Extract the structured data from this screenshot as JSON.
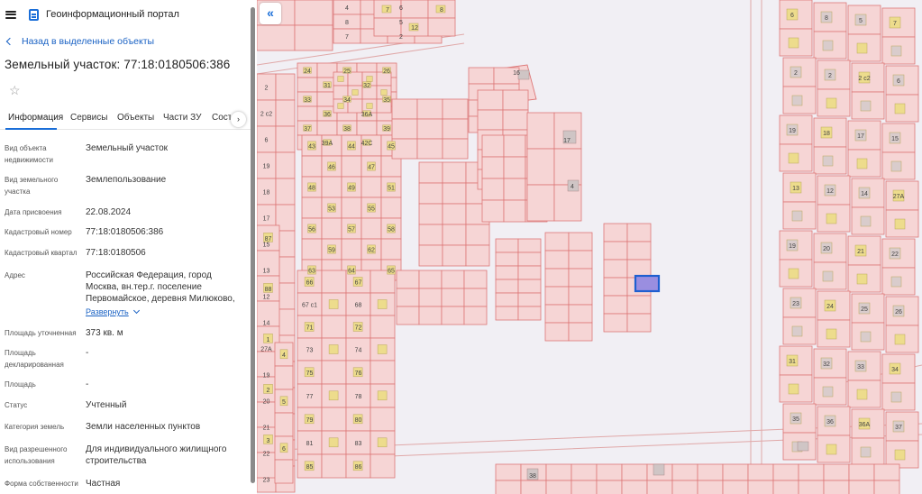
{
  "header": {
    "app_title": "Геоинформационный портал",
    "menu_icon": "hamburger-icon",
    "logo_icon": "portal-logo-icon"
  },
  "back_link": {
    "label": "Назад в выделенные объекты"
  },
  "object": {
    "title": "Земельный участок: 77:18:0180506:386"
  },
  "tabs": [
    {
      "label": "Информация",
      "active": true
    },
    {
      "label": "Сервисы"
    },
    {
      "label": "Объекты"
    },
    {
      "label": "Части ЗУ"
    },
    {
      "label": "Состав"
    }
  ],
  "tabs_more_icon": "chevron-right-icon",
  "properties": {
    "type": {
      "label": "Вид объекта недвижимости",
      "value": "Земельный участок"
    },
    "land_kind": {
      "label": "Вид земельного участка",
      "value": "Землепользование"
    },
    "assigned_date": {
      "label": "Дата присвоения",
      "value": "22.08.2024"
    },
    "cad_number": {
      "label": "Кадастровый номер",
      "value": "77:18:0180506:386"
    },
    "cad_block": {
      "label": "Кадастровый квартал",
      "value": "77:18:0180506"
    },
    "address": {
      "label": "Адрес",
      "value": "Российская Федерация, город Москва, вн.тер.г. поселение Первомайское, деревня Милюково,",
      "expand": "Развернуть"
    },
    "area_specified": {
      "label": "Площадь уточненная",
      "value": "373 кв. м"
    },
    "area_declared": {
      "label": "Площадь декларированная",
      "value": "-"
    },
    "area": {
      "label": "Площадь",
      "value": "-"
    },
    "status": {
      "label": "Статус",
      "value": "Учтенный"
    },
    "category": {
      "label": "Категория земель",
      "value": "Земли населенных пунктов"
    },
    "permitted_use": {
      "label": "Вид разрешенного использования",
      "value": "Для индивидуального жилищного строительства"
    },
    "ownership": {
      "label": "Форма собственности",
      "value": "Частная"
    }
  },
  "map": {
    "collapse_icon": "double-chevron-left-icon",
    "labels": [
      "4",
      "6",
      "8",
      "5",
      "7",
      "2",
      "2",
      "2 с2",
      "6",
      "19",
      "18",
      "17",
      "15",
      "13",
      "12",
      "14",
      "27А",
      "19",
      "20",
      "21",
      "22",
      "23",
      "24",
      "25",
      "26",
      "31",
      "32",
      "33",
      "34",
      "35",
      "36",
      "36А",
      "37",
      "38",
      "39",
      "39А",
      "42С",
      "43",
      "44",
      "45",
      "46",
      "47",
      "48",
      "49",
      "51",
      "53",
      "55",
      "56",
      "57",
      "58",
      "59",
      "62",
      "63",
      "64",
      "65",
      "66",
      "67",
      "67 с1",
      "68",
      "71",
      "72",
      "73",
      "74",
      "75",
      "76",
      "77",
      "78",
      "79",
      "80",
      "81",
      "83",
      "85",
      "86",
      "87",
      "88",
      "1",
      "2",
      "3",
      "4",
      "5",
      "6",
      "7",
      "8",
      "12",
      "16",
      "17"
    ]
  },
  "colors": {
    "accent": "#1a6ed8",
    "parcel_fill": "#f6d5d5",
    "parcel_stroke": "#dd7777",
    "building": "#eddc8c",
    "selected": "#1f5fd0"
  }
}
